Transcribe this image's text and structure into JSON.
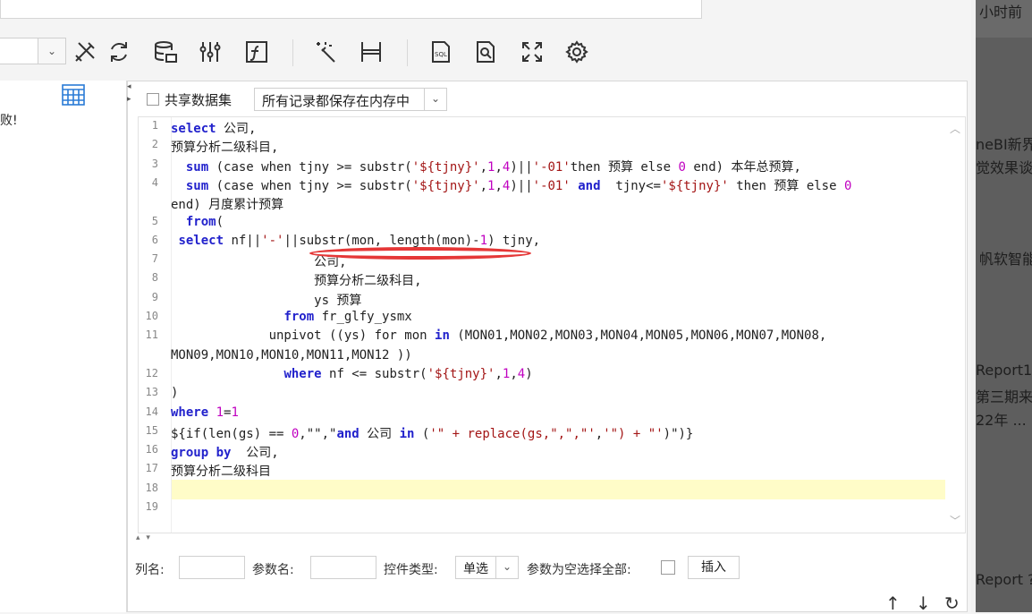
{
  "right_panel": {
    "items": [
      "小时前",
      "neBI新界",
      "觉效果谈",
      "帆软智能",
      "Report1",
      "第三期来",
      "22年 ...",
      "Report ?"
    ]
  },
  "left_pane": {
    "message": "败!"
  },
  "dataset_options": {
    "shared_label": "共享数据集",
    "storage_mode": "所有记录都保存在内存中"
  },
  "toolbar": {
    "icons": [
      "tools-icon",
      "refresh-icon",
      "sql-database-icon",
      "sliders-icon",
      "formula-icon",
      "magic-wand-icon",
      "column-split-icon",
      "sql-file-icon",
      "search-file-icon",
      "expand-icon",
      "settings-icon"
    ]
  },
  "editor": {
    "line_numbers": [
      "1",
      "2",
      "3",
      "4",
      "",
      "5",
      "6",
      "7",
      "8",
      "9",
      "10",
      "11",
      "",
      "12",
      "13",
      "14",
      "15",
      "16",
      "17",
      "18",
      "19"
    ],
    "lines": [
      "select 公司,",
      "预算分析二级科目,",
      "  sum (case when tjny >= substr('${tjny}',1,4)||'-01'then 预算 else 0 end) 本年总预算,",
      "  sum (case when tjny >= substr('${tjny}',1,4)||'-01' and  tjny<='${tjny}' then 预算 else 0",
      "end) 月度累计预算",
      "  from(",
      " select nf||'-'||substr(mon, length(mon)-1) tjny,",
      "                   公司,",
      "                   预算分析二级科目,",
      "                   ys 预算",
      "               from fr_glfy_ysmx",
      "             unpivot ((ys) for mon in (MON01,MON02,MON03,MON04,MON05,MON06,MON07,MON08,",
      "MON09,MON10,MON10,MON11,MON12 ))",
      "               where nf <= substr('${tjny}',1,4)",
      ")",
      "where 1=1",
      "${if(len(gs) == 0,\"\",\"and 公司 in ('\" + replace(gs,\",\",\"','\") + \"')\")}",
      "group by  公司,",
      "预算分析二级科目",
      "",
      ""
    ]
  },
  "param_form": {
    "col_label": "列名:",
    "param_label": "参数名:",
    "control_label": "控件类型:",
    "control_value": "单选",
    "select_all_label": "参数为空选择全部:",
    "insert_button": "插入"
  },
  "colors": {
    "keyword": "#2222cc",
    "string": "#a31515",
    "number": "#c000c0",
    "highlight": "#fffcc8",
    "annotation": "#e53737"
  }
}
